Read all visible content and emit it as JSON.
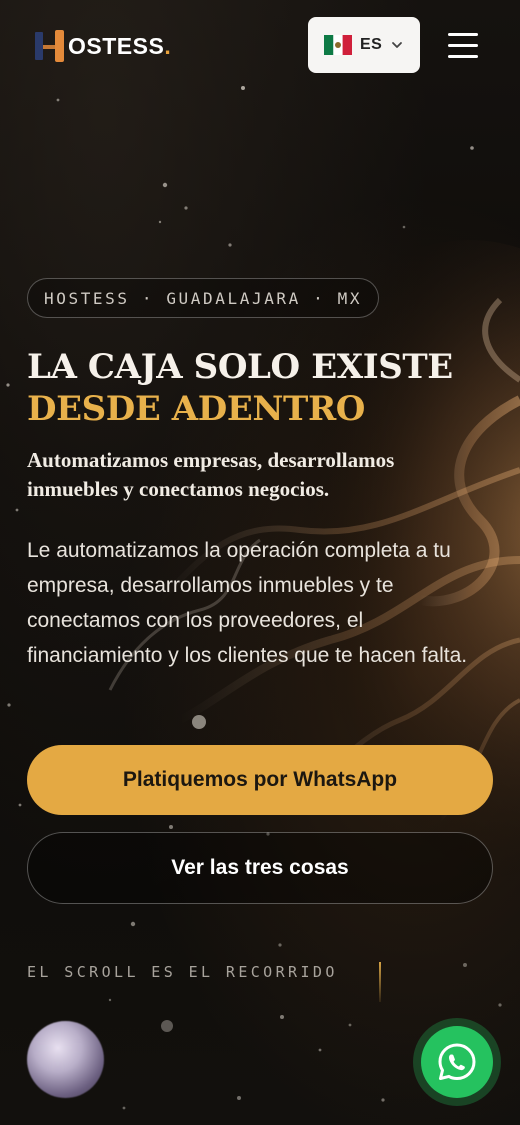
{
  "header": {
    "logo_text": "OSTESS",
    "logo_dot": ".",
    "language": {
      "code": "ES",
      "flag_icon": "mexico-flag-icon"
    },
    "menu_icon": "hamburger-menu-icon"
  },
  "hero": {
    "tag": "HOSTESS · GUADALAJARA · MX",
    "headline_line1": "LA CAJA SOLO EXISTE",
    "headline_line2": "DESDE ADENTRO",
    "subhead": "Automatizamos empresas, desarrollamos inmuebles y conectamos negocios.",
    "body": "Le automatizamos la operación completa a tu empresa, desarrollamos inmuebles y te conectamos con los proveedores, el financiamiento y los clientes que te hacen falta.",
    "primary_cta": "Platiquemos por WhatsApp",
    "secondary_cta": "Ver las tres cosas",
    "scroll_hint": "EL SCROLL ES EL RECORRIDO"
  },
  "floating": {
    "whatsapp_icon": "whatsapp-icon"
  },
  "colors": {
    "accent_gold": "#e4a943",
    "headline_gold": "#e8b14b",
    "whatsapp_green": "#25c25f",
    "background": "#0d0b09"
  }
}
